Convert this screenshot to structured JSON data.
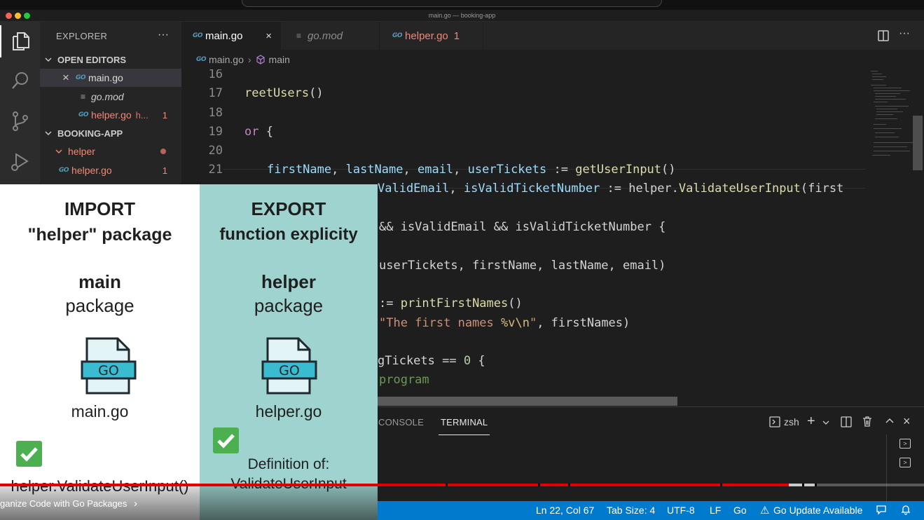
{
  "window": {
    "title": "main.go — booking-app"
  },
  "activity_bar": {
    "items": [
      "files-icon",
      "search-icon",
      "source-control-icon",
      "run-debug-icon"
    ]
  },
  "sidebar": {
    "header": "EXPLORER",
    "more": "···",
    "open_editors_label": "OPEN EDITORS",
    "open_editors": [
      {
        "go_tag": "GO",
        "name": "main.go",
        "close": "×"
      },
      {
        "name": "go.mod"
      },
      {
        "go_tag": "GO",
        "name": "helper.go",
        "path": "h...",
        "problems": "1"
      }
    ],
    "project_label": "BOOKING-APP",
    "folder": {
      "name": "helper"
    },
    "folder_file": {
      "go_tag": "GO",
      "name": "helper.go",
      "problems": "1"
    }
  },
  "tabs": [
    {
      "go_tag": "GO",
      "label": "main.go",
      "close": "×"
    },
    {
      "label": "go.mod"
    },
    {
      "go_tag": "GO",
      "label": "helper.go",
      "problems": "1"
    }
  ],
  "breadcrumb": {
    "go_tag": "GO",
    "file": "main.go",
    "symbol": "main"
  },
  "editor": {
    "line_numbers": [
      "16",
      "17",
      "18",
      "19",
      "20",
      "21"
    ],
    "l17": {
      "fn": "reetUsers",
      "rest": "()"
    },
    "l19": {
      "kw": "or",
      "rest": " {"
    },
    "l21": {
      "v1": "firstName",
      "c1": ", ",
      "v2": "lastName",
      "c2": ", ",
      "v3": "email",
      "c3": ", ",
      "v4": "userTickets",
      "op": " := ",
      "fn": "getUserInput",
      "rest": "()"
    },
    "l22": {
      "v1": "ValidEmail",
      "c1": ", ",
      "v2": "isValidTicketNumber",
      "op": " := helper.",
      "fn": "ValidateUserInput",
      "rest": "(first"
    },
    "l24": {
      "text": "&& isValidEmail && isValidTicketNumber {"
    },
    "l26": {
      "text": "userTickets, firstName, lastName, email)"
    },
    "l28": {
      "op": ":= ",
      "fn": "printFirstNames",
      "rest": "()"
    },
    "l29": {
      "s1": "\"The first names ",
      "esc1": "%v\\n",
      "s2": "\"",
      "rest": ", firstNames)"
    },
    "l31": {
      "pre": "gTickets == ",
      "num": "0",
      "rest": " {"
    },
    "l32": {
      "cmt": "program"
    }
  },
  "panel": {
    "tabs": [
      "CONSOLE",
      "TERMINAL"
    ],
    "active_tab": "TERMINAL",
    "shell": "zsh"
  },
  "status_bar": {
    "position": "Ln 22, Col 67",
    "tab_size": "Tab Size: 4",
    "encoding": "UTF-8",
    "eol": "LF",
    "language": "Go",
    "update": "Go Update Available"
  },
  "slide": {
    "left": {
      "title1": "IMPORT",
      "title2": "\"helper\" package",
      "pkg1": "main",
      "pkg2": "package",
      "file_icon_text": "GO",
      "file": "main.go",
      "caption": "helper.ValidateUserInput()"
    },
    "right": {
      "title1": "EXPORT",
      "title2": "function explicity",
      "pkg1": "helper",
      "pkg2": "package",
      "file_icon_text": "GO",
      "file": "helper.go",
      "caption1": "Definition of:",
      "caption2": "ValidateUserInput"
    },
    "colors": {
      "left_bg": "#ffffff",
      "right_bg": "#9fd3cf",
      "check": "#4caf50",
      "go_icon": "#3bbbd0"
    }
  },
  "video": {
    "chapter": "ganize Code with Go Packages",
    "chevron": "›",
    "progress": 0.854
  },
  "colors": {
    "accent": "#007acc",
    "progress": "#e00000"
  }
}
